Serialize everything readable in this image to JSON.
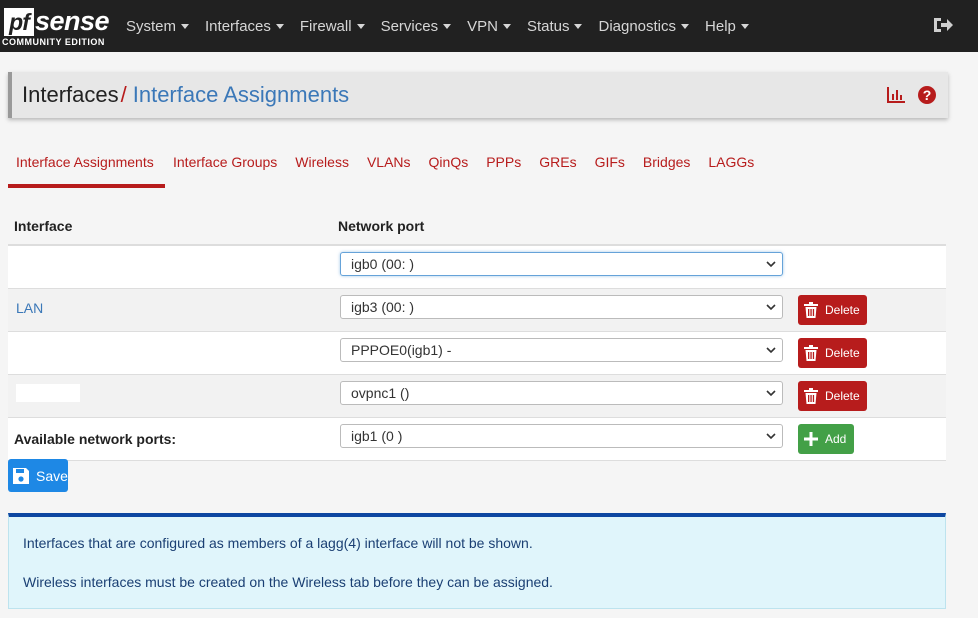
{
  "brand": {
    "logo_pf": "pf",
    "logo_sense": "sense",
    "edition": "COMMUNITY EDITION"
  },
  "nav": [
    "System",
    "Interfaces",
    "Firewall",
    "Services",
    "VPN",
    "Status",
    "Diagnostics",
    "Help"
  ],
  "breadcrumb": {
    "parent": "Interfaces",
    "separator": "/",
    "current": "Interface Assignments"
  },
  "tabs": [
    "Interface Assignments",
    "Interface Groups",
    "Wireless",
    "VLANs",
    "QinQs",
    "PPPs",
    "GREs",
    "GIFs",
    "Bridges",
    "LAGGs"
  ],
  "active_tab": "Interface Assignments",
  "table": {
    "headers": {
      "interface": "Interface",
      "port": "Network port"
    },
    "rows": [
      {
        "interface": "",
        "port": "igb0 (00:         )",
        "delete": ""
      },
      {
        "interface": "LAN",
        "port": "igb3 (00:         )",
        "delete": "Delete"
      },
      {
        "interface": "",
        "port": "PPPOE0(igb1) - ",
        "delete": "Delete"
      },
      {
        "interface": "",
        "port": "ovpnc1 ()",
        "delete": "Delete"
      }
    ],
    "available": {
      "label": "Available network ports:",
      "port": "igb1 (0         )",
      "add": "Add"
    }
  },
  "save_label": "Save",
  "info": [
    "Interfaces that are configured as members of a lagg(4) interface will not be shown.",
    "Wireless interfaces must be created on the Wireless tab before they can be assigned."
  ],
  "colors": {
    "accent": "#b71c1c",
    "link": "#3b78b8",
    "navbar": "#212121",
    "save": "#1e88e5",
    "add": "#43a047",
    "info_bg": "#e0f5fb"
  },
  "icons": [
    "logout-icon",
    "chart-icon",
    "help-icon",
    "chevron-down-icon",
    "trash-icon",
    "plus-icon",
    "save-icon"
  ]
}
